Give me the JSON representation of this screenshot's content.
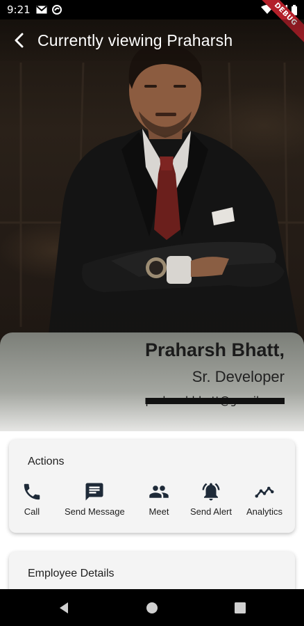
{
  "status_bar": {
    "time": "9:21",
    "left_icons": [
      "gmail-icon",
      "data-saver-icon"
    ],
    "right_icons": [
      "wifi-icon",
      "signal-icon",
      "battery-icon"
    ],
    "debug_label": "DEBUG"
  },
  "app_bar": {
    "title": "Currently viewing Praharsh",
    "back_icon": "arrow-back-icon"
  },
  "profile": {
    "name": "Praharsh Bhatt,",
    "role": "Sr. Developer",
    "email": "praharshbhatt@gmail.com"
  },
  "actions_card": {
    "title": "Actions",
    "items": [
      {
        "label": "Call",
        "icon": "phone-icon"
      },
      {
        "label": "Send Message",
        "icon": "message-icon"
      },
      {
        "label": "Meet",
        "icon": "people-icon"
      },
      {
        "label": "Send Alert",
        "icon": "alert-bell-icon"
      },
      {
        "label": "Analytics",
        "icon": "analytics-icon"
      }
    ]
  },
  "details_card": {
    "title": "Employee Details"
  },
  "nav_bar": {
    "icons": [
      "nav-back-icon",
      "nav-home-icon",
      "nav-recents-icon"
    ]
  },
  "colors": {
    "status_bar": "#000000",
    "icon": "#1e1e1e",
    "card_bg": "#f4f4f4",
    "debug_ribbon": "#b3202a"
  }
}
